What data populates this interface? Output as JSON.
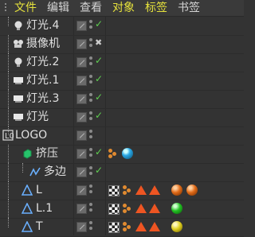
{
  "menu": {
    "items": [
      {
        "label": "文件",
        "active": true
      },
      {
        "label": "编辑",
        "active": false
      },
      {
        "label": "查看",
        "active": false
      },
      {
        "label": "对象",
        "active": true
      },
      {
        "label": "标签",
        "active": true
      },
      {
        "label": "书签",
        "active": false
      }
    ]
  },
  "objects": [
    {
      "name": "灯光.4",
      "icon": "light-bulb-icon",
      "status": "check"
    },
    {
      "name": "摄像机",
      "icon": "camera-icon",
      "status": "x"
    },
    {
      "name": "灯光.2",
      "icon": "light-bulb-icon",
      "status": "check"
    },
    {
      "name": "灯光.1",
      "icon": "area-light-icon",
      "status": "check"
    },
    {
      "name": "灯光.3",
      "icon": "area-light-icon",
      "status": "check"
    },
    {
      "name": "灯光",
      "icon": "area-light-icon",
      "status": "check"
    },
    {
      "name": "LOGO",
      "icon": "null-object-icon",
      "status": "none"
    },
    {
      "name": "挤压",
      "icon": "extrude-icon",
      "status": "check"
    },
    {
      "name": "多边",
      "icon": "spline-icon",
      "status": "check"
    },
    {
      "name": "L",
      "icon": "polygon-object-icon",
      "status": "none"
    },
    {
      "name": "L.1",
      "icon": "polygon-object-icon",
      "status": "none"
    },
    {
      "name": "T",
      "icon": "polygon-object-icon",
      "status": "none"
    }
  ],
  "colors": {
    "material_cyan": "#2aa8e6",
    "material_orange": "#e06a18",
    "material_green": "#22c022",
    "material_yellow": "#e0d020"
  }
}
